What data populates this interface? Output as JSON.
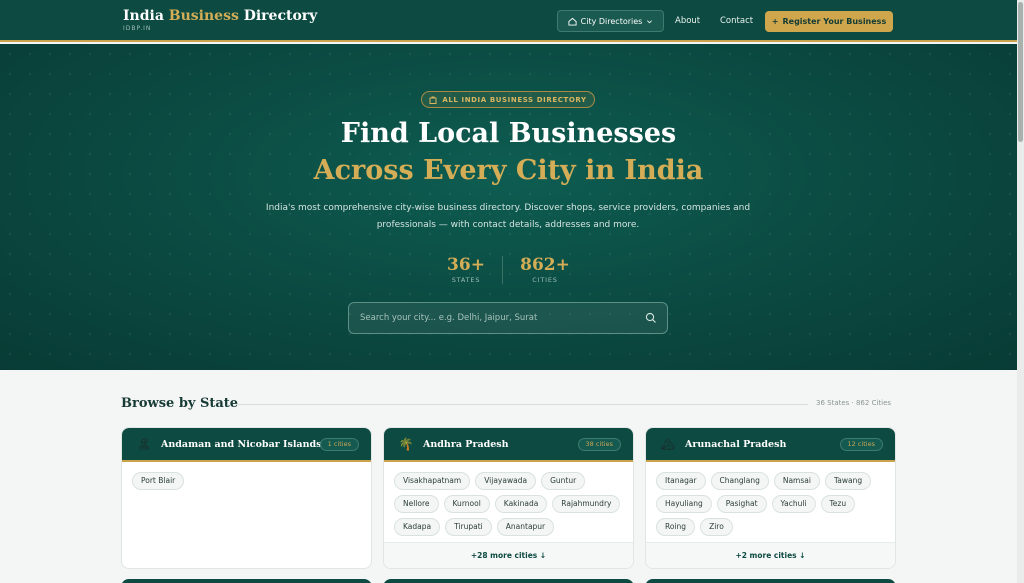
{
  "header": {
    "brand_prefix": "India",
    "brand_accent": "Business",
    "brand_suffix": "Directory",
    "brand_sub": "IDBP.IN",
    "nav_directories": "City Directories",
    "nav_about": "About",
    "nav_contact": "Contact",
    "register": "Register Your Business"
  },
  "hero": {
    "badge": "ALL INDIA BUSINESS DIRECTORY",
    "title_line1": "Find Local Businesses",
    "title_line2": "Across Every City in India",
    "description": "India's most comprehensive city-wise business directory. Discover shops, service providers, companies and professionals — with contact details, addresses and more.",
    "stats": [
      {
        "value": "36+",
        "label": "STATES"
      },
      {
        "value": "862+",
        "label": "CITIES"
      }
    ],
    "search_placeholder": "Search your city... e.g. Delhi, Jaipur, Surat"
  },
  "browse": {
    "title": "Browse by State",
    "meta": "36 States · 862 Cities",
    "cards": [
      {
        "name": "Andaman and Nicobar Islands",
        "icon": "island-icon",
        "emoji": "🏝",
        "count": "1 cities",
        "cities": [
          "Port Blair"
        ],
        "more": ""
      },
      {
        "name": "Andhra Pradesh",
        "icon": "palm-tree-icon",
        "emoji": "🌴",
        "count": "38 cities",
        "cities": [
          "Visakhapatnam",
          "Vijayawada",
          "Guntur",
          "Nellore",
          "Kurnool",
          "Kakinada",
          "Rajahmundry",
          "Kadapa",
          "Tirupati",
          "Anantapur"
        ],
        "more": "+28 more cities ↓"
      },
      {
        "name": "Arunachal Pradesh",
        "icon": "mountain-icon",
        "emoji": "🏔",
        "count": "12 cities",
        "cities": [
          "Itanagar",
          "Changlang",
          "Namsai",
          "Tawang",
          "Hayuliang",
          "Pasighat",
          "Yachuli",
          "Tezu",
          "Roing",
          "Ziro"
        ],
        "more": "+2 more cities ↓"
      }
    ]
  },
  "colors": {
    "primary": "#0d4a41",
    "accent": "#d0a64d",
    "background": "#f4f6f5"
  }
}
